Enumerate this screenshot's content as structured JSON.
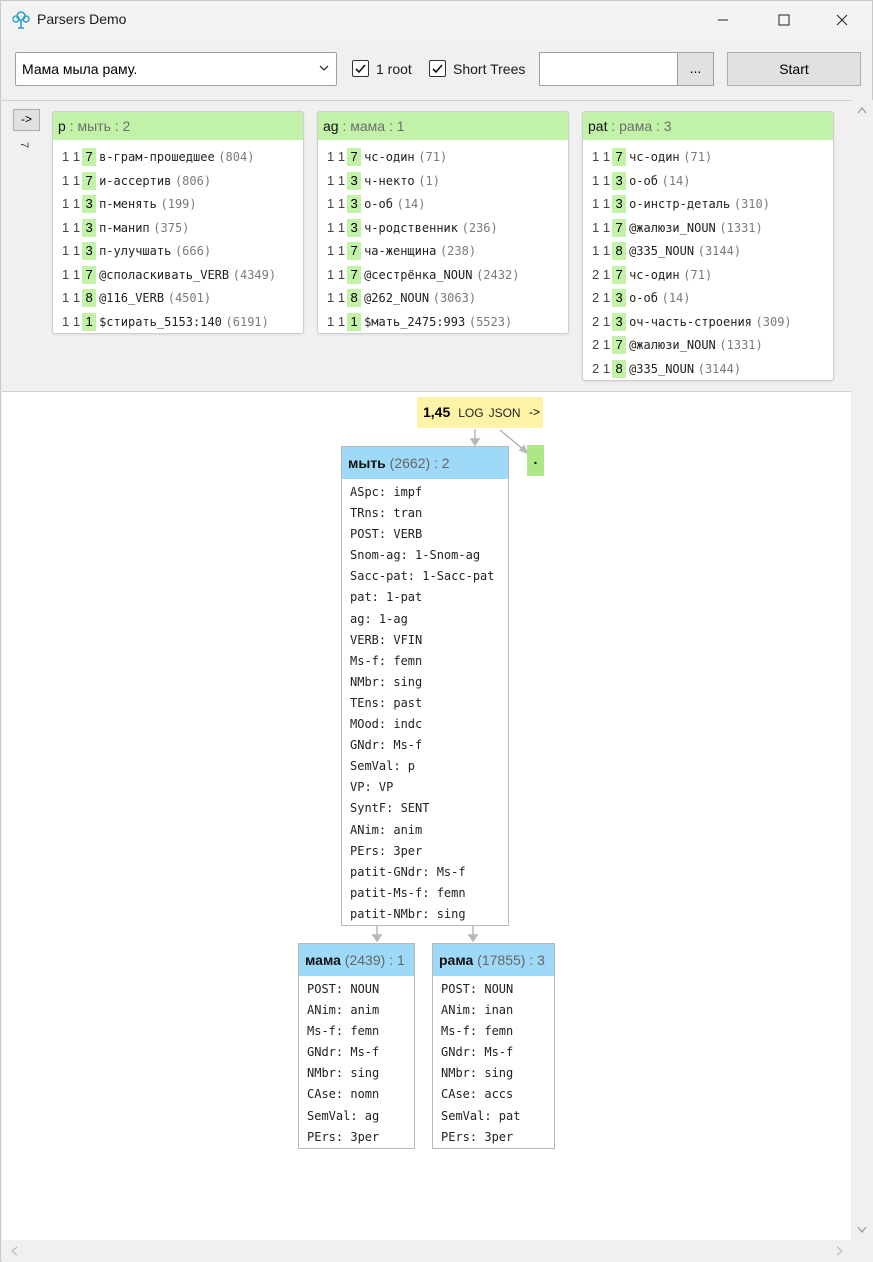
{
  "window": {
    "title": "Parsers Demo"
  },
  "toolbar": {
    "sentence": "Мама мыла раму.",
    "one_root_label": "1 root",
    "one_root_checked": true,
    "short_trees_label": "Short Trees",
    "short_trees_checked": true,
    "search_value": "",
    "dots_label": "...",
    "start_label": "Start"
  },
  "side": {
    "arrow_label": "->",
    "count": "7"
  },
  "panels": [
    {
      "role": "p",
      "rest": " : мыть  : 2",
      "rows": [
        {
          "ids": "1 1",
          "badge": "7",
          "text": "в-грам-прошедшее",
          "count": "(804)"
        },
        {
          "ids": "1 1",
          "badge": "7",
          "text": "и-ассертив",
          "count": "(806)"
        },
        {
          "ids": "1 1",
          "badge": "3",
          "text": "п-менять",
          "count": "(199)"
        },
        {
          "ids": "1 1",
          "badge": "3",
          "text": "п-манип",
          "count": "(375)"
        },
        {
          "ids": "1 1",
          "badge": "3",
          "text": "п-улучшать",
          "count": "(666)"
        },
        {
          "ids": "1 1",
          "badge": "7",
          "text": "@споласкивать_VERB",
          "count": "(4349)"
        },
        {
          "ids": "1 1",
          "badge": "8",
          "text": "@116_VERB",
          "count": "(4501)"
        },
        {
          "ids": "1 1",
          "badge": "1",
          "text": "$стирать_5153:140",
          "count": "(6191)"
        }
      ]
    },
    {
      "role": "ag",
      "rest": " : мама  : 1",
      "rows": [
        {
          "ids": "1 1",
          "badge": "7",
          "text": "чс-один",
          "count": "(71)"
        },
        {
          "ids": "1 1",
          "badge": "3",
          "text": "ч-некто",
          "count": "(1)"
        },
        {
          "ids": "1 1",
          "badge": "3",
          "text": "о-об",
          "count": "(14)"
        },
        {
          "ids": "1 1",
          "badge": "3",
          "text": "ч-родственник",
          "count": "(236)"
        },
        {
          "ids": "1 1",
          "badge": "7",
          "text": "ча-женщина",
          "count": "(238)"
        },
        {
          "ids": "1 1",
          "badge": "7",
          "text": "@сестрёнка_NOUN",
          "count": "(2432)"
        },
        {
          "ids": "1 1",
          "badge": "8",
          "text": "@262_NOUN",
          "count": "(3063)"
        },
        {
          "ids": "1 1",
          "badge": "1",
          "text": "$мать_2475:993",
          "count": "(5523)"
        }
      ]
    },
    {
      "role": "pat",
      "rest": " : рама  : 3",
      "rows": [
        {
          "ids": "1 1",
          "badge": "7",
          "text": "чс-один",
          "count": "(71)"
        },
        {
          "ids": "1 1",
          "badge": "3",
          "text": "о-об",
          "count": "(14)"
        },
        {
          "ids": "1 1",
          "badge": "3",
          "text": "о-инстр-деталь",
          "count": "(310)"
        },
        {
          "ids": "1 1",
          "badge": "7",
          "text": "@жалюзи_NOUN",
          "count": "(1331)"
        },
        {
          "ids": "1 1",
          "badge": "8",
          "text": "@335_NOUN",
          "count": "(3144)"
        },
        {
          "ids": "2 1",
          "badge": "7",
          "text": "чс-один",
          "count": "(71)"
        },
        {
          "ids": "2 1",
          "badge": "3",
          "text": "о-об",
          "count": "(14)"
        },
        {
          "ids": "2 1",
          "badge": "3",
          "text": "оч-часть-строения",
          "count": "(309)"
        },
        {
          "ids": "2 1",
          "badge": "7",
          "text": "@жалюзи_NOUN",
          "count": "(1331)"
        },
        {
          "ids": "2 1",
          "badge": "8",
          "text": "@335_NOUN",
          "count": "(3144)"
        }
      ]
    }
  ],
  "tree": {
    "score": "1,45",
    "log_label": "LOG",
    "json_label": "JSON",
    "arrow_label": "->",
    "punct": ".",
    "root": {
      "word": "мыть",
      "meta": " (2662) : 2",
      "features": [
        "ASpc: impf",
        "TRns: tran",
        "POST: VERB",
        "Snom-ag: 1-Snom-ag",
        "Sacc-pat: 1-Sacc-pat",
        "pat: 1-pat",
        "ag: 1-ag",
        "VERB: VFIN",
        "Ms-f: femn",
        "NMbr: sing",
        "TEns: past",
        "MOod: indc",
        "GNdr: Ms-f",
        "SemVal: p",
        "VP: VP",
        "SyntF: SENT",
        "ANim: anim",
        "PErs: 3per",
        "patit-GNdr: Ms-f",
        "patit-Ms-f: femn",
        "patit-NMbr: sing"
      ]
    },
    "children": [
      {
        "word": "мама",
        "meta": " (2439) : 1",
        "features": [
          "POST: NOUN",
          "ANim: anim",
          "Ms-f: femn",
          "GNdr: Ms-f",
          "NMbr: sing",
          "CAse: nomn",
          "SemVal: ag",
          "PErs: 3per"
        ]
      },
      {
        "word": "рама",
        "meta": " (17855) : 3",
        "features": [
          "POST: NOUN",
          "ANim: inan",
          "Ms-f: femn",
          "GNdr: Ms-f",
          "NMbr: sing",
          "CAse: accs",
          "SemVal: pat",
          "PErs: 3per"
        ]
      }
    ]
  },
  "colors": {
    "panel_header": "#c2f1a8",
    "node_header": "#9ed9f7",
    "score_bg": "#fff3a8",
    "punct_bg": "#aee886"
  }
}
